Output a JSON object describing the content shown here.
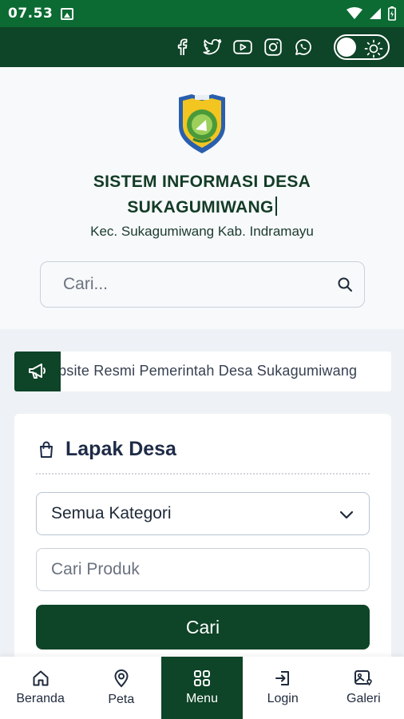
{
  "statusbar": {
    "time": "07.53"
  },
  "header": {
    "social_icons": [
      "facebook-icon",
      "twitter-icon",
      "youtube-icon",
      "instagram-icon",
      "whatsapp-icon"
    ],
    "theme_toggle": "sun-icon"
  },
  "hero": {
    "title_line1": "SISTEM INFORMASI DESA",
    "title_line2": "SUKAGUMIWANG",
    "subtitle": "Kec. Sukagumiwang Kab. Indramayu",
    "search_placeholder": "Cari..."
  },
  "ticker": {
    "text": "Website Resmi Pemerintah Desa Sukagumiwang"
  },
  "lapak": {
    "title": "Lapak Desa",
    "category_selected": "Semua Kategori",
    "product_placeholder": "Cari Produk",
    "button_label": "Cari"
  },
  "bottom_nav": {
    "items": [
      {
        "label": "Beranda",
        "icon": "home-icon"
      },
      {
        "label": "Peta",
        "icon": "map-pin-icon"
      },
      {
        "label": "Menu",
        "icon": "grid-icon",
        "active": true
      },
      {
        "label": "Login",
        "icon": "login-icon"
      },
      {
        "label": "Galeri",
        "icon": "gallery-icon"
      }
    ]
  },
  "colors": {
    "primary": "#0e4427",
    "statusbar": "#0b6b33",
    "title": "#133b26",
    "card_title": "#1e2b47"
  }
}
